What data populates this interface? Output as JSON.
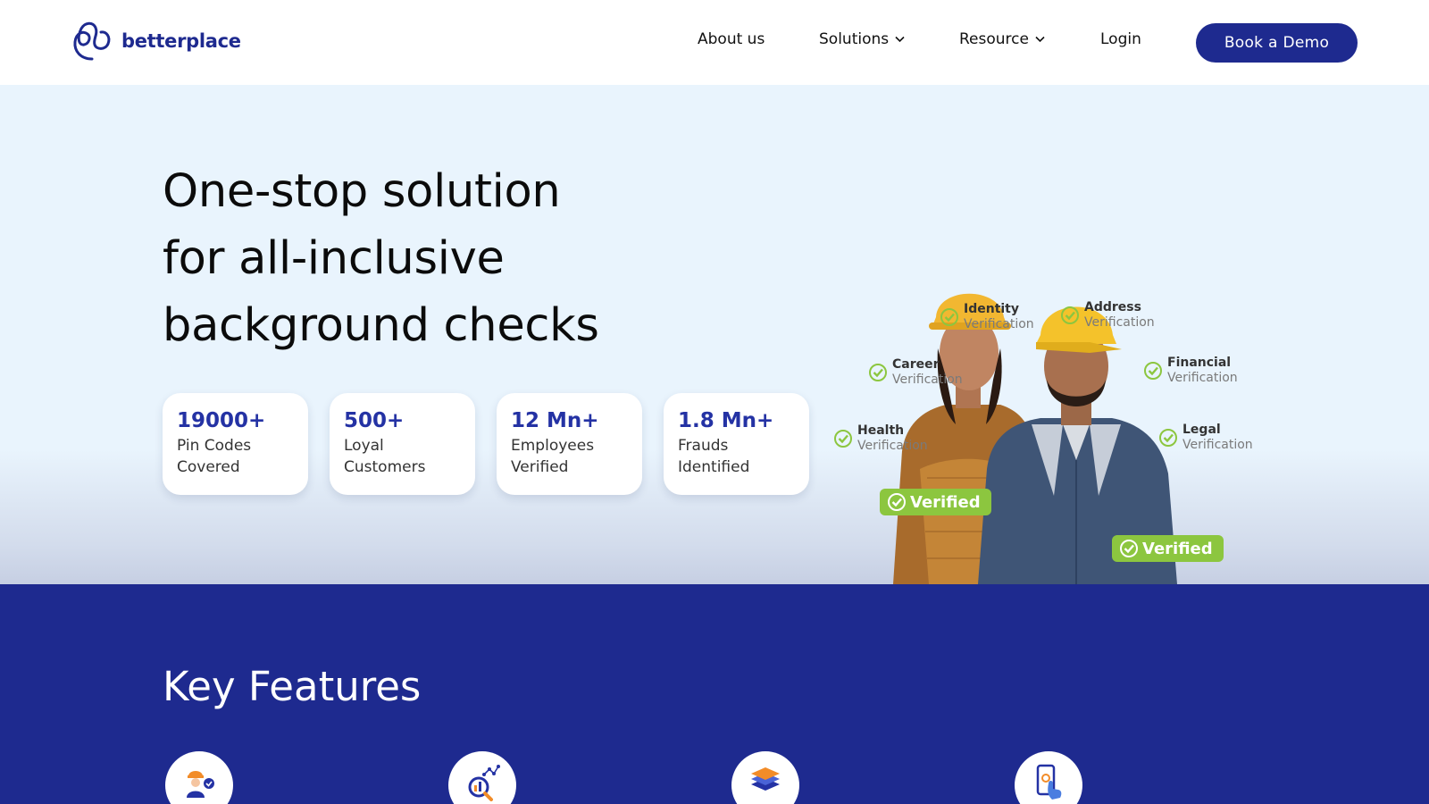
{
  "brand": {
    "name": "betterplace",
    "primary_color": "#1e2a8f",
    "accent_blue": "#2432a4",
    "verified_green": "#8cc63f"
  },
  "nav": {
    "items": [
      {
        "label": "About us"
      },
      {
        "label": "Solutions",
        "icon": "chevron-down-icon"
      },
      {
        "label": "Resource",
        "icon": "chevron-down-icon"
      },
      {
        "label": "Login"
      }
    ],
    "cta_label": "Book a Demo"
  },
  "hero": {
    "title_lines": [
      "One-stop solution",
      "for all-inclusive",
      "background checks"
    ],
    "stats": [
      {
        "value": "19000+",
        "label": "Pin Codes Covered"
      },
      {
        "value": "500+",
        "label": "Loyal Customers"
      },
      {
        "value": "12 Mn+",
        "label": "Employees Verified"
      },
      {
        "value": "1.8 Mn+",
        "label": "Frauds Identified"
      }
    ],
    "verifications": [
      {
        "title": "Identity",
        "subtitle": "Verification"
      },
      {
        "title": "Address",
        "subtitle": "Verification"
      },
      {
        "title": "Career",
        "subtitle": "Verification"
      },
      {
        "title": "Financial",
        "subtitle": "Verification"
      },
      {
        "title": "Health",
        "subtitle": "Verification"
      },
      {
        "title": "Legal",
        "subtitle": "Verification"
      }
    ],
    "badges": [
      "Verified",
      "Verified"
    ]
  },
  "features": {
    "title": "Key Features",
    "icons": [
      "worker-check-icon",
      "analytics-search-icon",
      "layers-stack-icon",
      "mobile-tap-icon"
    ]
  }
}
